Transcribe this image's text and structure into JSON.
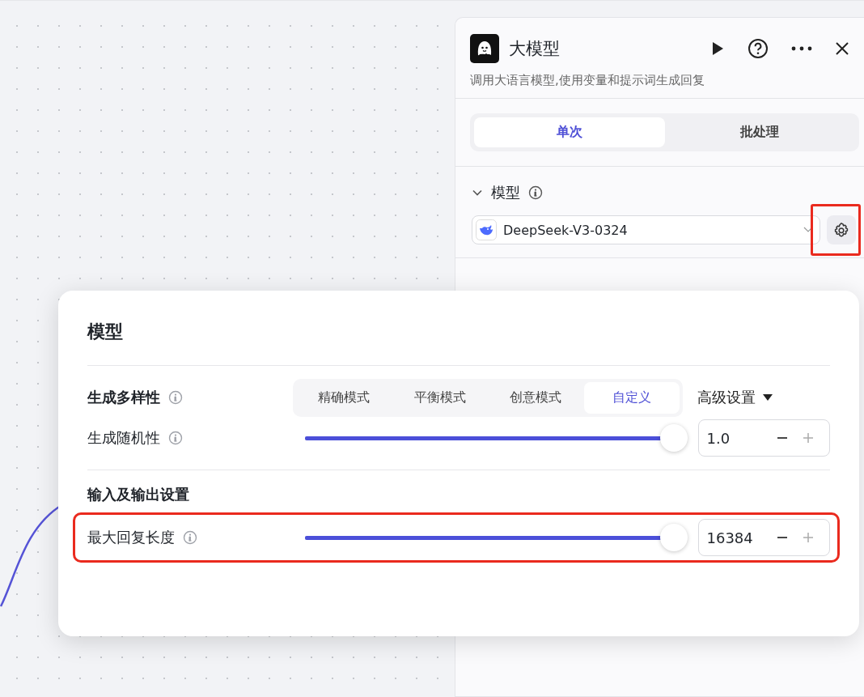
{
  "panel": {
    "title": "大模型",
    "description": "调用大语言模型,使用变量和提示词生成回复",
    "tabs": [
      {
        "label": "单次",
        "selected": true
      },
      {
        "label": "批处理",
        "selected": false
      }
    ],
    "model_section": {
      "label": "模型",
      "expanded": true,
      "model": "DeepSeek-V3-0324",
      "settings_highlighted": true
    }
  },
  "popup": {
    "title": "模型",
    "diversity": {
      "label": "生成多样性",
      "modes": [
        {
          "label": "精确模式",
          "selected": false
        },
        {
          "label": "平衡模式",
          "selected": false
        },
        {
          "label": "创意模式",
          "selected": false
        },
        {
          "label": "自定义",
          "selected": true
        }
      ],
      "advanced": "高级设置"
    },
    "sliders": [
      {
        "label": "生成随机性",
        "level": 1.0,
        "value": "1.0",
        "highlighted": false
      }
    ],
    "io_title": "输入及输出设置",
    "io_sliders": [
      {
        "label": "最大回复长度",
        "level": 1.0,
        "value": "16384",
        "highlighted": true
      }
    ]
  }
}
